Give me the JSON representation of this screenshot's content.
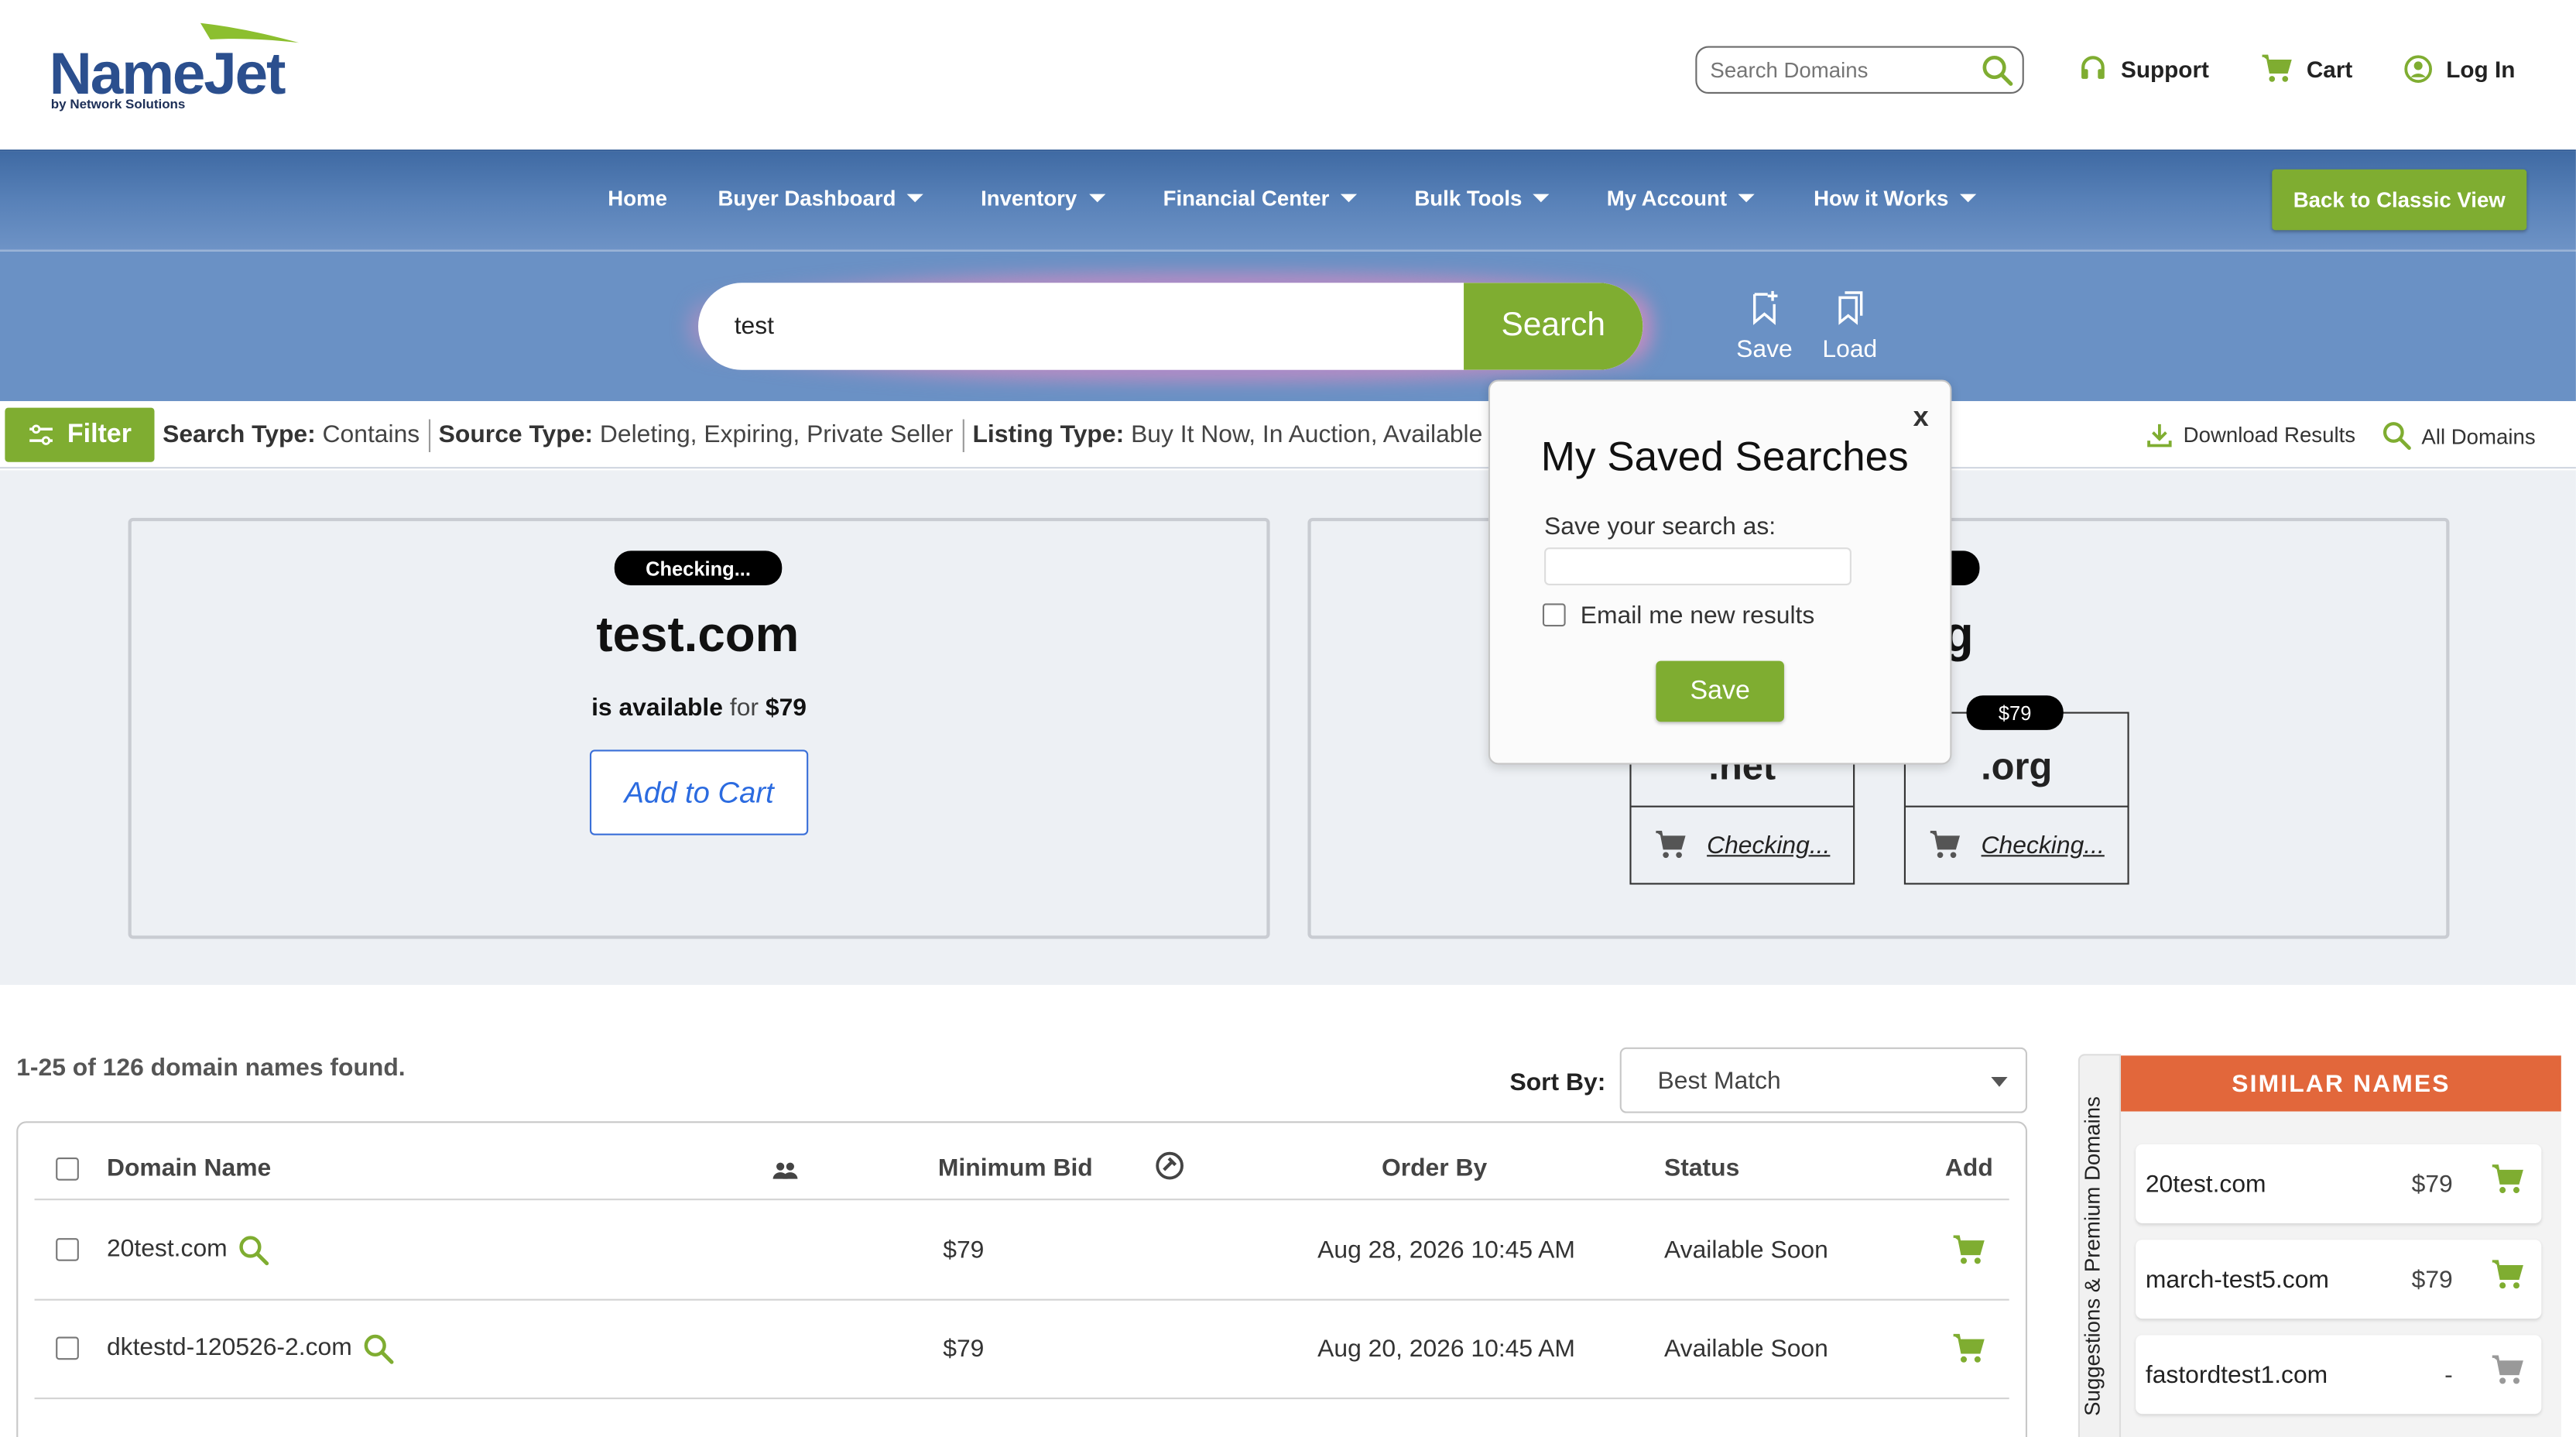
{
  "header": {
    "logo_name": "NameJet",
    "logo_sub": "by Network Solutions",
    "search_placeholder": "Search Domains",
    "support": "Support",
    "cart": "Cart",
    "login": "Log In"
  },
  "nav": {
    "items": [
      {
        "label": "Home"
      },
      {
        "label": "Buyer Dashboard"
      },
      {
        "label": "Inventory"
      },
      {
        "label": "Financial Center"
      },
      {
        "label": "Bulk Tools"
      },
      {
        "label": "My Account"
      },
      {
        "label": "How it Works"
      }
    ],
    "classic_button": "Back to Classic View"
  },
  "search": {
    "value": "test",
    "button": "Search",
    "save": "Save",
    "load": "Load"
  },
  "filter": {
    "button": "Filter",
    "search_type_label": "Search Type:",
    "search_type": "Contains",
    "source_type_label": "Source Type:",
    "source_type": "Deleting, Expiring, Private Seller",
    "listing_type_label": "Listing Type:",
    "listing_type": "Buy It Now, In Auction, Available",
    "download": "Download Results",
    "all_domains": "All Domains"
  },
  "card_primary": {
    "status": "Checking...",
    "domain": "test.com",
    "available": "is available",
    "for": "for",
    "price": "$79",
    "add_to_cart": "Add to Cart"
  },
  "card_secondary": {
    "domain_fragment": "g",
    "tlds": [
      {
        "name": ".net",
        "status": "Checking..."
      },
      {
        "name": ".org",
        "price": "$79",
        "status": "Checking..."
      }
    ]
  },
  "modal": {
    "close": "x",
    "title": "My Saved Searches",
    "label": "Save your search as:",
    "value": "",
    "email_label": "Email me new results",
    "save": "Save"
  },
  "results": {
    "found": "1-25 of 126 domain names found.",
    "sort_label": "Sort By:",
    "sort_value": "Best Match",
    "columns": {
      "domain": "Domain Name",
      "min_bid": "Minimum Bid",
      "order_by": "Order By",
      "status": "Status",
      "add": "Add"
    },
    "rows": [
      {
        "domain": "20test.com",
        "bid": "$79",
        "order_by": "Aug 28, 2026 10:45 AM",
        "status": "Available Soon"
      },
      {
        "domain": "dktestd-120526-2.com",
        "bid": "$79",
        "order_by": "Aug 20, 2026 10:45 AM",
        "status": "Available Soon"
      }
    ]
  },
  "similar": {
    "tab_label": "Suggestions & Premium Domains",
    "title": "SIMILAR NAMES",
    "items": [
      {
        "name": "20test.com",
        "price": "$79"
      },
      {
        "name": "march-test5.com",
        "price": "$79"
      },
      {
        "name": "fastordtest1.com",
        "price": "-"
      }
    ]
  },
  "colors": {
    "brand_blue": "#2b4f8e",
    "nav_blue": "#5881b8",
    "accent_green": "#7fad31",
    "similar_orange": "#e2673b"
  }
}
